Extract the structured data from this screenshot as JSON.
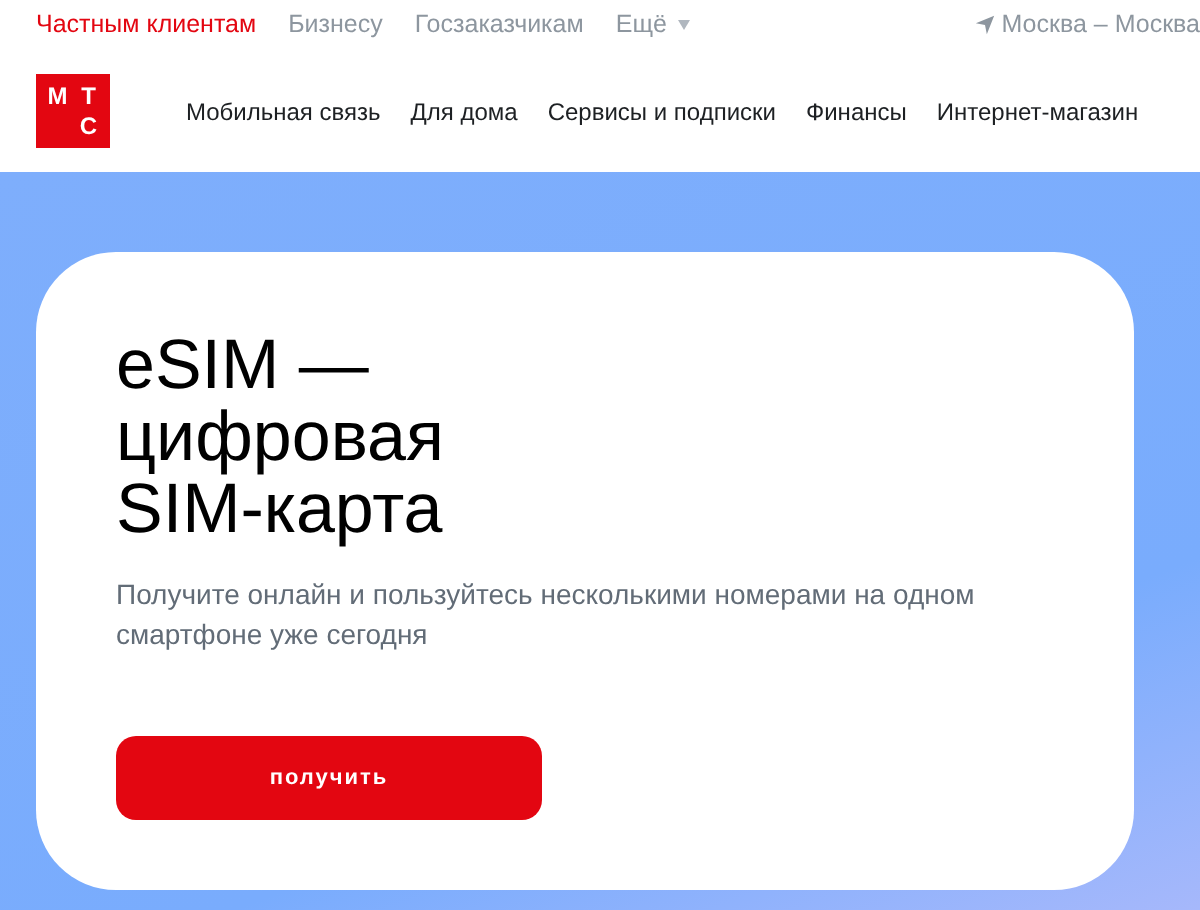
{
  "top_tabs": [
    {
      "label": "Частным клиентам",
      "selected": true
    },
    {
      "label": "Бизнесу",
      "selected": false
    },
    {
      "label": "Госзаказчикам",
      "selected": false
    },
    {
      "label": "Ещё",
      "selected": false,
      "dropdown": true
    }
  ],
  "region": "Москва – Москва",
  "logo": {
    "letters": [
      "М",
      "Т",
      "С"
    ]
  },
  "main_nav": [
    "Мобильная связь",
    "Для дома",
    "Сервисы и подписки",
    "Финансы",
    "Интернет-магазин"
  ],
  "hero": {
    "title_lines": [
      "eSIM —",
      "цифровая",
      "SIM-карта"
    ],
    "subtitle": "Получите онлайн и пользуйтесь несколькими номерами на одном смартфоне уже сегодня",
    "button": "получить"
  }
}
